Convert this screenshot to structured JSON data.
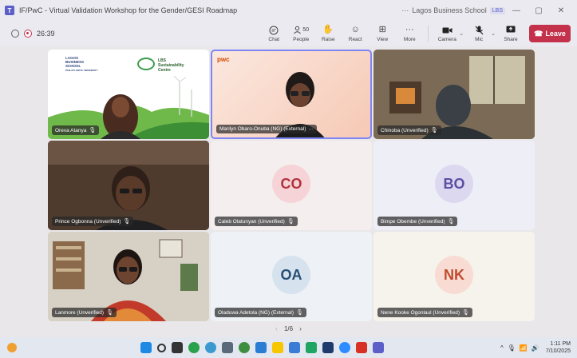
{
  "window": {
    "title": "IF/PwC - Virtual Validation Workshop for the Gender/GESI Roadmap",
    "org": "Lagos Business School",
    "org_badge": "LBS",
    "minimize": "—",
    "maximize": "▢",
    "close": "✕"
  },
  "toolbar": {
    "timer": "26:39",
    "chat": "Chat",
    "people_count": "50",
    "people": "People",
    "raise": "Raise",
    "react": "React",
    "view": "View",
    "more": "More",
    "camera": "Camera",
    "mic": "Mic",
    "share": "Share",
    "leave": "Leave"
  },
  "participants": [
    {
      "name": "Oreva Atanya",
      "muted": true
    },
    {
      "name": "Marilyn Obaro-Onuba (NG) (External)",
      "muted": false,
      "extra": "···"
    },
    {
      "name": "Chinoba (Unverified)",
      "muted": true
    },
    {
      "name": "Prince Ogbonna (Unverified)",
      "muted": true
    },
    {
      "name": "Caleb Olatunyan (Unverified)",
      "initials": "CO",
      "muted": true
    },
    {
      "name": "Bimpe Obembe (Unverified)",
      "initials": "BO",
      "muted": true
    },
    {
      "name": "Lanmore (Unverified)",
      "muted": true
    },
    {
      "name": "Oladuwa Adetola (NG) (External)",
      "initials": "OA",
      "muted": true
    },
    {
      "name": "Nene Kooke Ogonlaul (Unverified)",
      "initials": "NK",
      "muted": true
    }
  ],
  "slide": {
    "school_line1": "LAGOS",
    "school_line2": "BUSINESS",
    "school_line3": "SCHOOL",
    "school_line4": "PAN-ATLANTIC UNIVERSITY",
    "centre_line1": "LBS",
    "centre_line2": "Sustainability",
    "centre_line3": "Centre"
  },
  "pwc_logo": "pwc",
  "pager": {
    "prev": "‹",
    "text": "1/6",
    "next": "›"
  },
  "clock": {
    "time": "1:11 PM",
    "date": "7/10/2025"
  },
  "colors": {
    "accent": "#5b5fc7",
    "leave": "#c4314b",
    "co": "#d24f5a",
    "bo": "#7b6fc3",
    "oa": "#2f5f8a",
    "nk": "#e0624a"
  }
}
